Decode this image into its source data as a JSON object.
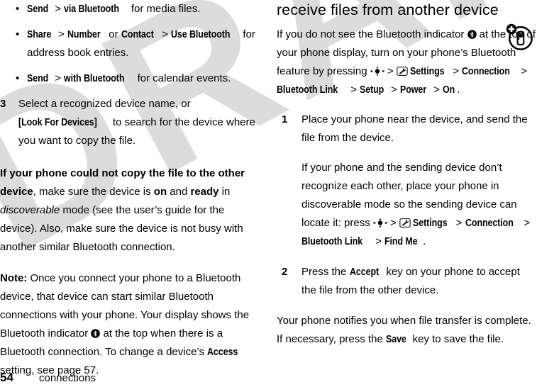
{
  "document": {
    "watermark": "DRAFT",
    "footer": {
      "page_number": "54",
      "section": "connections"
    }
  },
  "icons": {
    "bluetooth_indicator": "bluetooth-indicator-icon",
    "center_key": "center-select-key-icon",
    "settings_menu": "settings-wrench-icon",
    "corner_device": "add-device-icon"
  },
  "left_column": {
    "bullets": [
      {
        "menu_1": "Send",
        "sep_1": " > ",
        "menu_2": "via Bluetooth",
        "tail": " for media files."
      },
      {
        "menu_1": "Share",
        "sep_1": " > ",
        "menu_2": "Number",
        "sep_2": " or ",
        "menu_3": "Contact",
        "sep_3": " > ",
        "menu_4": "Use Bluetooth",
        "tail": " for address book entries."
      },
      {
        "menu_1": "Send",
        "sep_1": " > ",
        "menu_2": "with Bluetooth",
        "tail": " for calendar events."
      }
    ],
    "step_3": {
      "number": "3",
      "text_before": "Select a recognized device name, or ",
      "menu": "[Look For Devices]",
      "text_after": " to search for the device where you want to copy the file."
    },
    "troubleshoot": {
      "lead_bold": "If your phone could not copy the file to the other device",
      "part_1": ", make sure the device is ",
      "bold_on": "on",
      "part_2": " and ",
      "bold_ready": "ready",
      "part_3": " in ",
      "italic_discoverable": "discoverable",
      "part_4": " mode (see the user’s guide for the device). Also, make sure the device is not busy with another similar Bluetooth connection."
    },
    "note": {
      "label": "Note:",
      "part_1": " Once you connect your phone to a Bluetooth device, that device can start similar Bluetooth connections with your phone. Your display shows the Bluetooth indicator ",
      "part_2": " at the top when there is a Bluetooth connection. To change a device’s ",
      "menu_access": "Access",
      "part_3": " setting, see page 57."
    }
  },
  "right_column": {
    "heading": "receive files from another device",
    "intro": {
      "part_1": "If you do not see the Bluetooth indicator ",
      "part_2": " at the top of your phone display, turn on your phone’s Bluetooth feature by pressing ",
      "sep_1": " > ",
      "menu_settings": "Settings",
      "sep_2": " > ",
      "menu_connection": "Connection",
      "sep_3": " > ",
      "menu_bluetooth_link": "Bluetooth Link",
      "sep_4": " > ",
      "menu_setup": "Setup",
      "sep_5": " > ",
      "menu_power": "Power",
      "sep_6": " > ",
      "menu_on": "On",
      "tail": "."
    },
    "step_1": {
      "number": "1",
      "text": "Place your phone near the device, and send the file from the device.",
      "sub": {
        "part_1": "If your phone and the sending device don’t recognize each other, place your phone in discoverable mode so the sending device can locate it: press ",
        "sep_1": " > ",
        "menu_settings": "Settings",
        "sep_2": " > ",
        "menu_connection": "Connection",
        "sep_3": " > ",
        "menu_bluetooth_link": "Bluetooth Link",
        "sep_4": " > ",
        "menu_find_me": "Find Me",
        "tail": "."
      }
    },
    "step_2": {
      "number": "2",
      "text_before": "Press the ",
      "menu_accept": "Accept",
      "text_after": " key on your phone to accept the file from the other device."
    },
    "closing": {
      "part_1": "Your phone notifies you when file transfer is complete. If necessary, press the ",
      "menu_save": "Save",
      "part_2": " key to save the file."
    }
  },
  "colors": {
    "text": "#000000",
    "watermark": "#dcdcdc",
    "background": "#ffffff"
  }
}
